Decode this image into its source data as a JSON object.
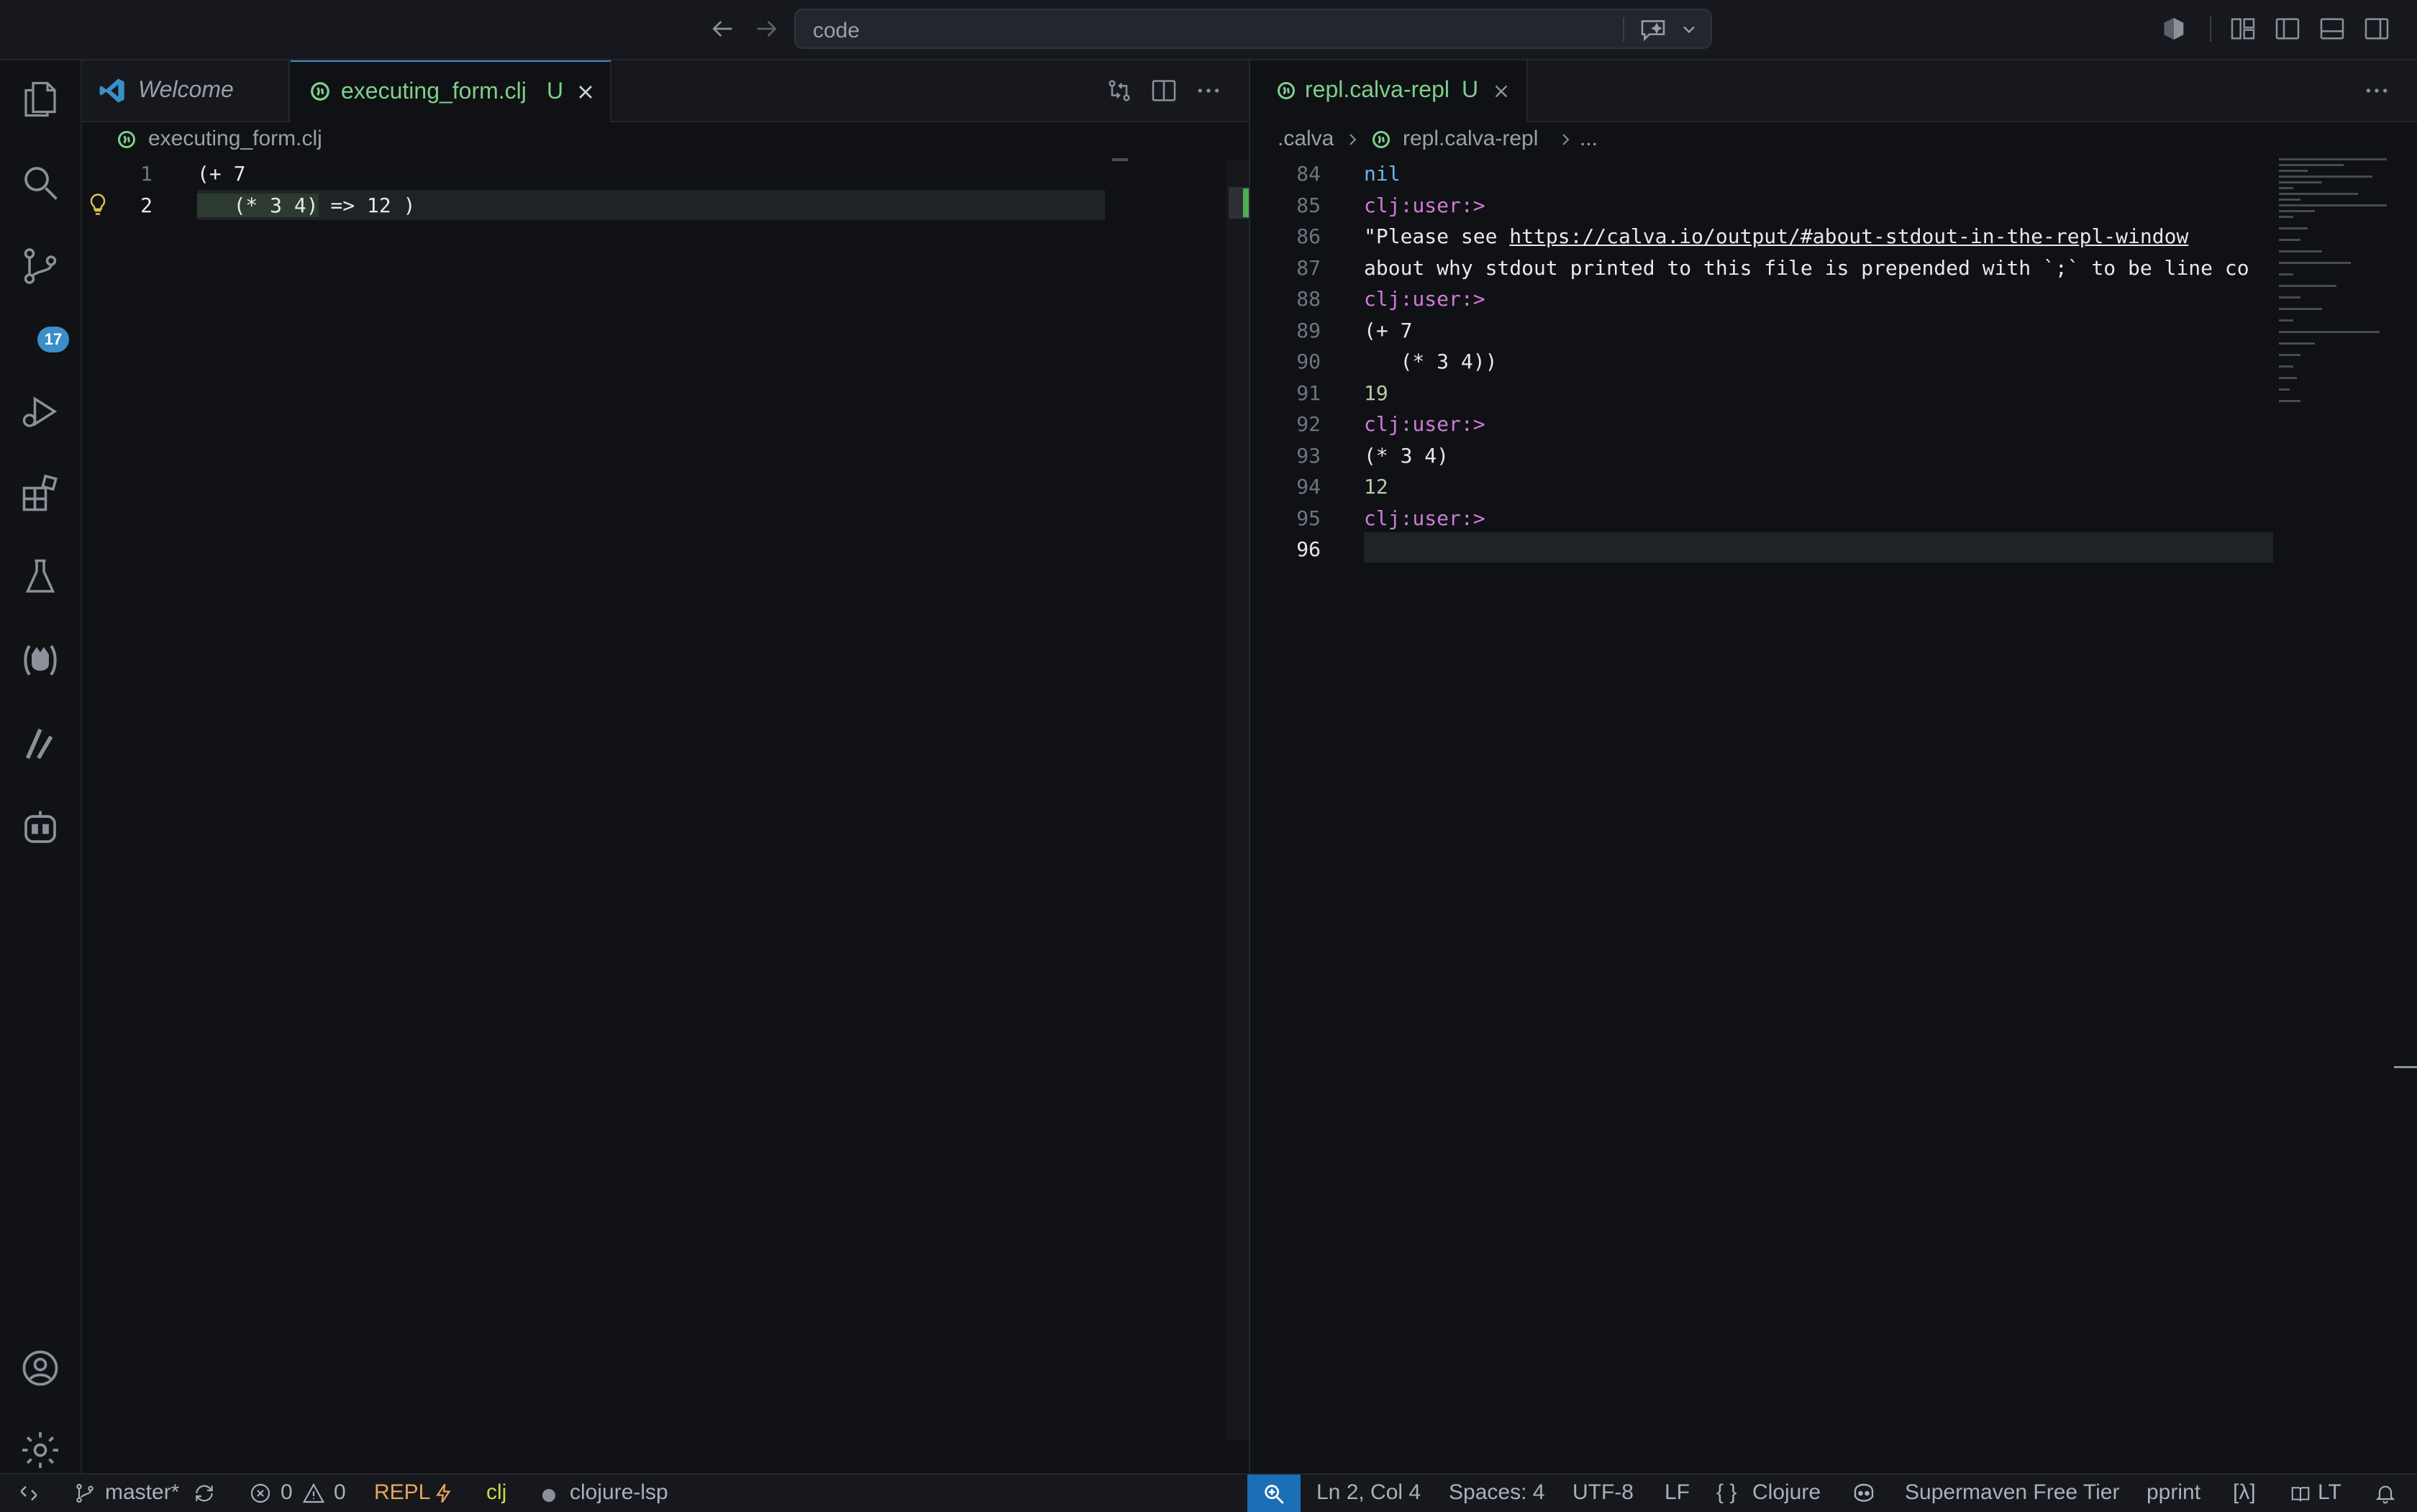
{
  "command_center": {
    "text": "code"
  },
  "activity_bar": {
    "scm_badge": "17"
  },
  "left_group": {
    "tabs": [
      {
        "label": "Welcome",
        "italic": true,
        "active": false
      },
      {
        "label": "executing_form.clj",
        "status": "U",
        "active": true
      }
    ],
    "breadcrumb": {
      "file": "executing_form.clj"
    },
    "lines": [
      {
        "num": "1",
        "text": "(+ 7"
      },
      {
        "num": "2",
        "text": "   (* 3 4)",
        "result": " => 12 )"
      }
    ]
  },
  "right_group": {
    "tab": {
      "label": "repl.calva-repl",
      "status": "U"
    },
    "breadcrumb": {
      "folder": ".calva",
      "file": "repl.calva-repl",
      "more": "..."
    },
    "lines": [
      {
        "num": "84",
        "text": "nil",
        "kind": "nil"
      },
      {
        "num": "85",
        "text": "clj:user:>",
        "kind": "prompt"
      },
      {
        "num": "86",
        "text": "\"Please see ",
        "link": "https://calva.io/output/#about-stdout-in-the-repl-window",
        "kind": "string"
      },
      {
        "num": "87",
        "text": "about why stdout printed to this file is prepended with `;` to be line co",
        "kind": "string"
      },
      {
        "num": "88",
        "text": "clj:user:>",
        "kind": "prompt"
      },
      {
        "num": "89",
        "text": "(+ 7",
        "kind": "code"
      },
      {
        "num": "90",
        "text": "   (* 3 4))",
        "kind": "code"
      },
      {
        "num": "91",
        "text": "19",
        "kind": "number"
      },
      {
        "num": "92",
        "text": "clj:user:>",
        "kind": "prompt"
      },
      {
        "num": "93",
        "text": "(* 3 4)",
        "kind": "code"
      },
      {
        "num": "94",
        "text": "12",
        "kind": "number"
      },
      {
        "num": "95",
        "text": "clj:user:>",
        "kind": "prompt"
      },
      {
        "num": "96",
        "text": "",
        "kind": "code"
      }
    ]
  },
  "status_bar": {
    "branch": "master*",
    "errors": "0",
    "warnings": "0",
    "repl": "REPL",
    "ns": "clj",
    "lsp": "clojure-lsp",
    "position": "Ln 2, Col 4",
    "spaces": "Spaces: 4",
    "encoding": "UTF-8",
    "eol": "LF",
    "language": "Clojure",
    "supermaven": "Supermaven Free Tier",
    "pprint": "pprint",
    "lambda": "[λ]",
    "lt": "LT"
  },
  "colors": {
    "accent": "#1a6fb5",
    "tab_modified": "#7fcf8a",
    "prompt_pink": "#d17ad9",
    "repl_orange": "#e9a35c",
    "ns_green": "#c7d94a",
    "nil_blue": "#6fb3e6"
  }
}
